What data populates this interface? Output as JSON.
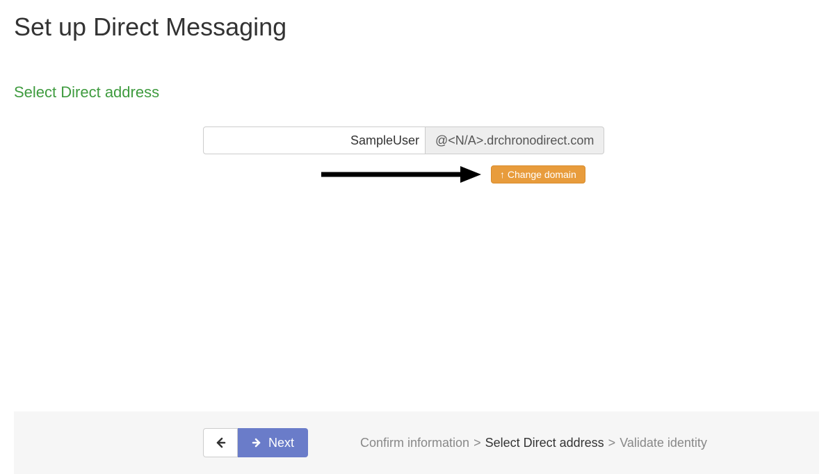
{
  "header": {
    "title": "Set up Direct Messaging"
  },
  "section": {
    "title": "Select Direct address"
  },
  "address": {
    "input_value": "SampleUser",
    "domain_suffix": "@<N/A>.drchronodirect.com"
  },
  "buttons": {
    "change_domain": "↑ Change domain",
    "next": "Next"
  },
  "breadcrumb": {
    "step1": "Confirm information",
    "step2": "Select Direct address",
    "step3": "Validate identity",
    "sep": ">"
  }
}
